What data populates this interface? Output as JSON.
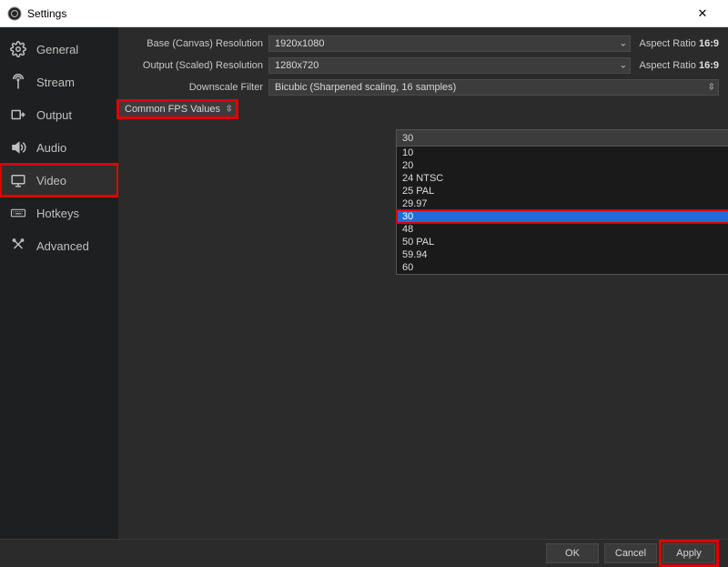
{
  "window": {
    "title": "Settings"
  },
  "sidebar": {
    "items": [
      {
        "label": "General"
      },
      {
        "label": "Stream"
      },
      {
        "label": "Output"
      },
      {
        "label": "Audio"
      },
      {
        "label": "Video"
      },
      {
        "label": "Hotkeys"
      },
      {
        "label": "Advanced"
      }
    ]
  },
  "video": {
    "base_label": "Base (Canvas) Resolution",
    "base_value": "1920x1080",
    "output_label": "Output (Scaled) Resolution",
    "output_value": "1280x720",
    "aspect_prefix": "Aspect Ratio ",
    "aspect_value": "16:9",
    "filter_label": "Downscale Filter",
    "filter_value": "Bicubic (Sharpened scaling, 16 samples)",
    "fps_mode_label": "Common FPS Values",
    "fps_selected": "30",
    "fps_options": [
      "10",
      "20",
      "24 NTSC",
      "25 PAL",
      "29.97",
      "30",
      "48",
      "50 PAL",
      "59.94",
      "60"
    ]
  },
  "footer": {
    "ok": "OK",
    "cancel": "Cancel",
    "apply": "Apply"
  }
}
